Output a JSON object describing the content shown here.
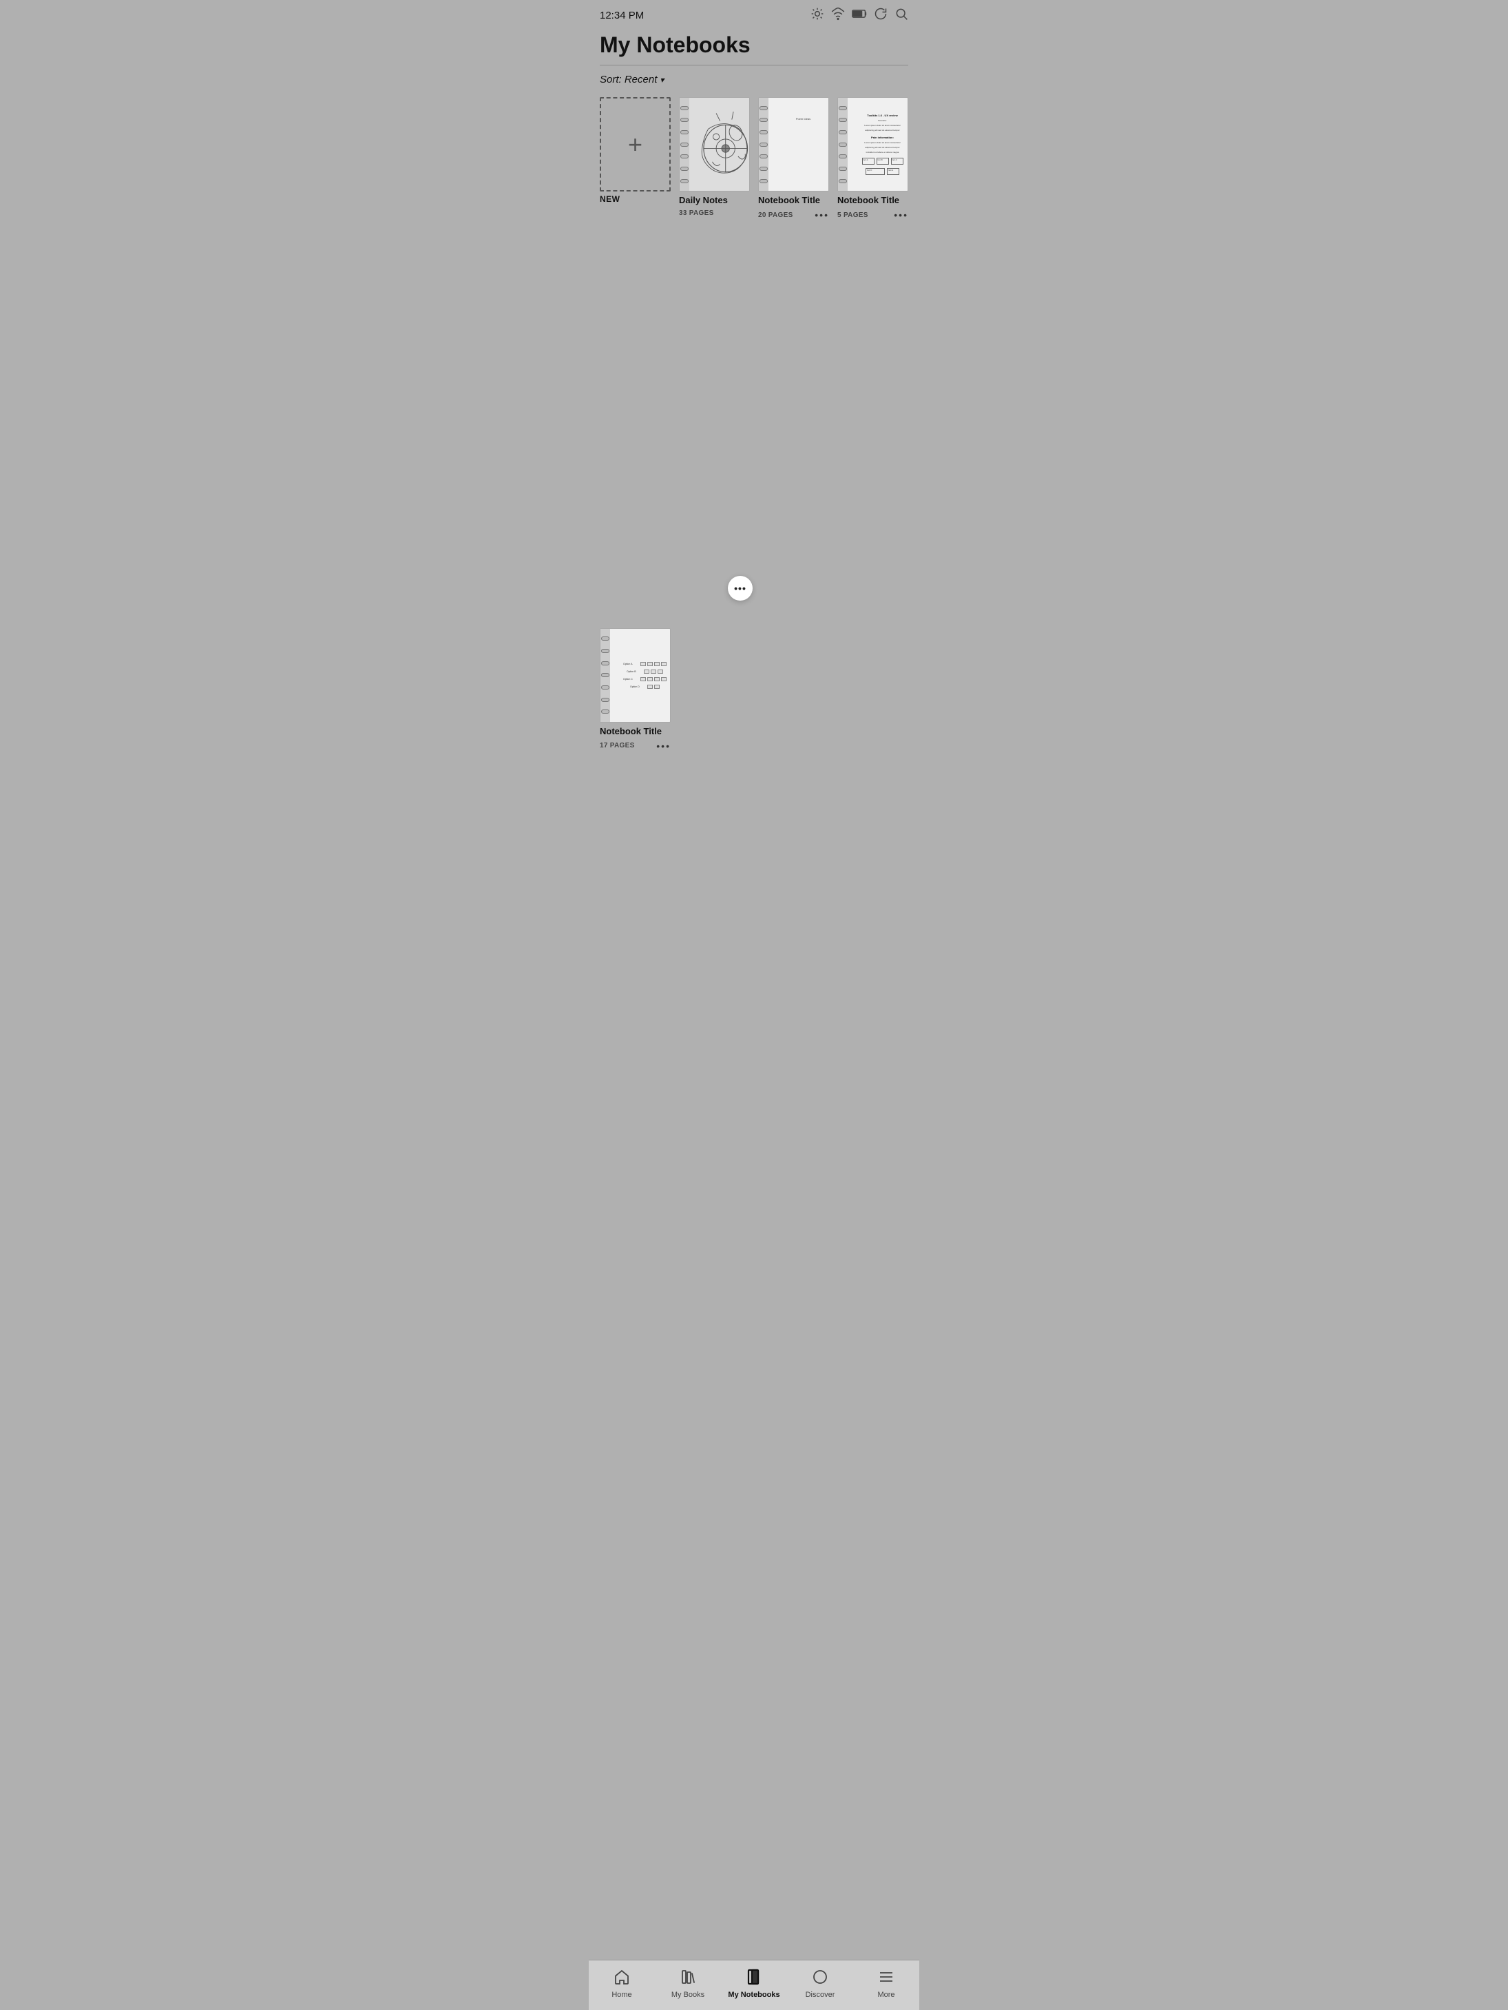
{
  "statusBar": {
    "time": "12:34 PM"
  },
  "header": {
    "title": "My Notebooks"
  },
  "sort": {
    "label": "Sort: Recent",
    "chevron": "▾"
  },
  "notebooks": [
    {
      "id": "new",
      "type": "new",
      "label": "NEW"
    },
    {
      "id": "daily-notes",
      "type": "sketch",
      "title": "Daily Notes",
      "pages": "33 PAGES",
      "moreActive": true
    },
    {
      "id": "notebook-2",
      "type": "lined",
      "title": "Notebook Title",
      "pages": "20 PAGES",
      "moreActive": false
    },
    {
      "id": "notebook-3",
      "type": "text",
      "title": "Notebook Title",
      "pages": "5 PAGES",
      "moreActive": false
    },
    {
      "id": "notebook-4",
      "type": "options",
      "title": "Notebook Title",
      "pages": "17 PAGES",
      "moreActive": false
    }
  ],
  "bottomNav": {
    "items": [
      {
        "id": "home",
        "label": "Home",
        "active": false
      },
      {
        "id": "my-books",
        "label": "My Books",
        "active": false
      },
      {
        "id": "my-notebooks",
        "label": "My Notebooks",
        "active": true
      },
      {
        "id": "discover",
        "label": "Discover",
        "active": false
      },
      {
        "id": "more",
        "label": "More",
        "active": false
      }
    ]
  }
}
